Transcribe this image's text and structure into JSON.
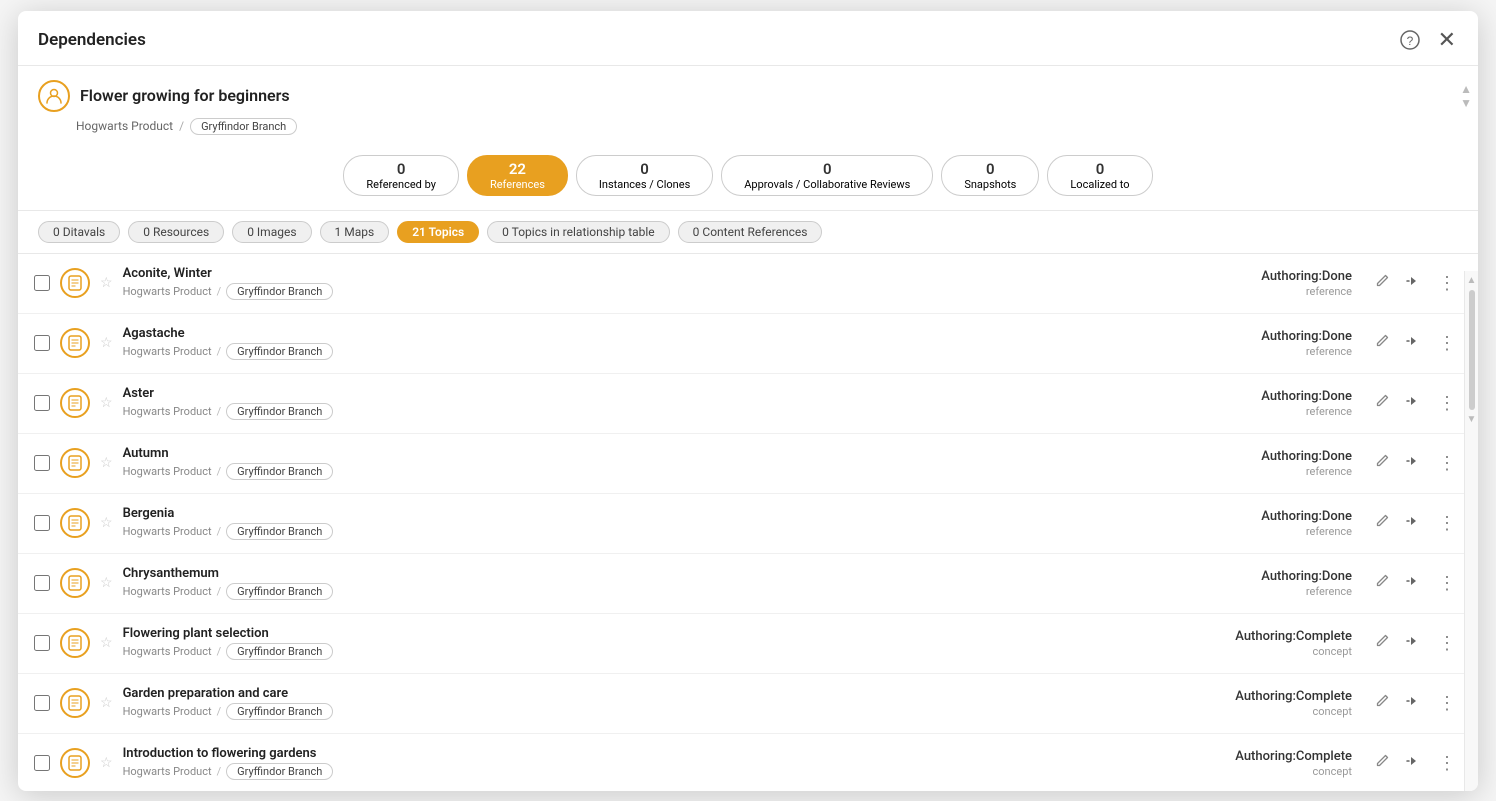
{
  "modal": {
    "title": "Dependencies",
    "help_icon": "?",
    "close_icon": "×"
  },
  "topic": {
    "title": "Flower growing for beginners",
    "icon": "👤",
    "breadcrumb_root": "Hogwarts Product",
    "breadcrumb_sep": "/",
    "branch": "Gryffindor Branch"
  },
  "tabs": [
    {
      "count": "0",
      "label": "Referenced by",
      "active": false
    },
    {
      "count": "22",
      "label": "References",
      "active": true
    },
    {
      "count": "0",
      "label": "Instances / Clones",
      "active": false
    },
    {
      "count": "0",
      "label": "Approvals / Collaborative Reviews",
      "active": false
    },
    {
      "count": "0",
      "label": "Snapshots",
      "active": false
    },
    {
      "count": "0",
      "label": "Localized to",
      "active": false
    }
  ],
  "filters": [
    {
      "label": "0 Ditavals",
      "active": false
    },
    {
      "label": "0 Resources",
      "active": false
    },
    {
      "label": "0 Images",
      "active": false
    },
    {
      "label": "1 Maps",
      "active": false
    },
    {
      "label": "21 Topics",
      "active": true
    },
    {
      "label": "0 Topics in relationship table",
      "active": false
    },
    {
      "label": "0 Content References",
      "active": false
    }
  ],
  "items": [
    {
      "name": "Aconite, Winter",
      "breadcrumb_root": "Hogwarts Product",
      "branch": "Gryffindor Branch",
      "status": "Authoring:Done",
      "type": "reference"
    },
    {
      "name": "Agastache",
      "breadcrumb_root": "Hogwarts Product",
      "branch": "Gryffindor Branch",
      "status": "Authoring:Done",
      "type": "reference"
    },
    {
      "name": "Aster",
      "breadcrumb_root": "Hogwarts Product",
      "branch": "Gryffindor Branch",
      "status": "Authoring:Done",
      "type": "reference"
    },
    {
      "name": "Autumn",
      "breadcrumb_root": "Hogwarts Product",
      "branch": "Gryffindor Branch",
      "status": "Authoring:Done",
      "type": "reference"
    },
    {
      "name": "Bergenia",
      "breadcrumb_root": "Hogwarts Product",
      "branch": "Gryffindor Branch",
      "status": "Authoring:Done",
      "type": "reference"
    },
    {
      "name": "Chrysanthemum",
      "breadcrumb_root": "Hogwarts Product",
      "branch": "Gryffindor Branch",
      "status": "Authoring:Done",
      "type": "reference"
    },
    {
      "name": "Flowering plant selection",
      "breadcrumb_root": "Hogwarts Product",
      "branch": "Gryffindor Branch",
      "status": "Authoring:Complete",
      "type": "concept"
    },
    {
      "name": "Garden preparation and care",
      "breadcrumb_root": "Hogwarts Product",
      "branch": "Gryffindor Branch",
      "status": "Authoring:Complete",
      "type": "concept"
    },
    {
      "name": "Introduction to flowering gardens",
      "breadcrumb_root": "Hogwarts Product",
      "branch": "Gryffindor Branch",
      "status": "Authoring:Complete",
      "type": "concept"
    }
  ]
}
